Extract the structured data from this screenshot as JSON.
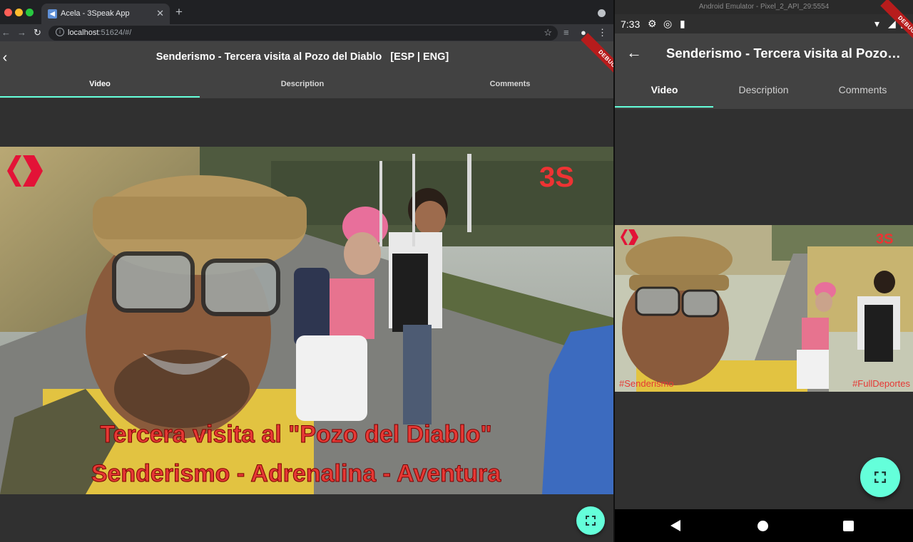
{
  "browser": {
    "tab_title": "Acela - 3Speak App",
    "tab_close": "✕",
    "new_tab": "+",
    "url_host": "localhost",
    "url_rest": ":51624/#/"
  },
  "web_app": {
    "title": "Senderismo - Tercera visita al Pozo del Diablo   [ESP | ENG]",
    "debug_label": "DEBUG",
    "tabs": [
      {
        "label": "Video"
      },
      {
        "label": "Description"
      },
      {
        "label": "Comments"
      }
    ],
    "video_overlay": {
      "line1": "Tercera visita al \"Pozo del Diablo\"",
      "line2": "Senderismo - Adrenalina - Aventura",
      "logo_text": "3S"
    }
  },
  "emulator": {
    "window_title": "Android Emulator - Pixel_2_API_29:5554",
    "status_time": "7:33",
    "app_title": "Senderismo - Tercera visita al Pozo del Diablo",
    "debug_label": "DEBUG",
    "tabs": [
      {
        "label": "Video"
      },
      {
        "label": "Description"
      },
      {
        "label": "Comments"
      }
    ],
    "video_overlay": {
      "left_tag": "#Senderismo",
      "right_tag": "#FullDeportes",
      "logo_text": "3S"
    }
  },
  "colors": {
    "accent": "#64ffda",
    "appbar": "#424242",
    "body": "#303030",
    "debug": "#b71c1c"
  }
}
